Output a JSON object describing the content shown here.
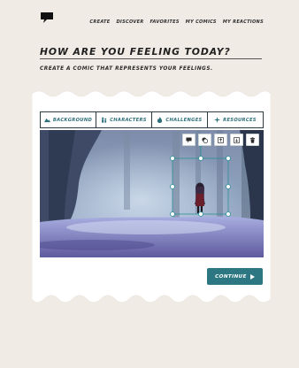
{
  "nav": {
    "items": [
      "CREATE",
      "DISCOVER",
      "FAVORITES",
      "MY COMICS",
      "MY REACTIONS"
    ]
  },
  "page": {
    "heading": "HOW ARE YOU FEELING TODAY?",
    "subheading": "CREATE A COMIC THAT REPRESENTS YOUR FEELINGS."
  },
  "editor": {
    "tabs": [
      {
        "label": "BACKGROUND",
        "icon": "mountain-icon"
      },
      {
        "label": "CHARACTERS",
        "icon": "people-icon"
      },
      {
        "label": "CHALLENGES",
        "icon": "fire-icon"
      },
      {
        "label": "RESOURCES",
        "icon": "sparkle-icon"
      }
    ],
    "toolbar_icons": [
      "speech-bubble-icon",
      "layer-icon",
      "bring-forward-icon",
      "send-backward-icon",
      "trash-icon"
    ],
    "continue_label": "CONTINUE"
  },
  "colors": {
    "accent": "#2d7782",
    "tab_text": "#2d6f7a",
    "page_bg": "#f0ebe4",
    "selection": "#2d8f97"
  }
}
